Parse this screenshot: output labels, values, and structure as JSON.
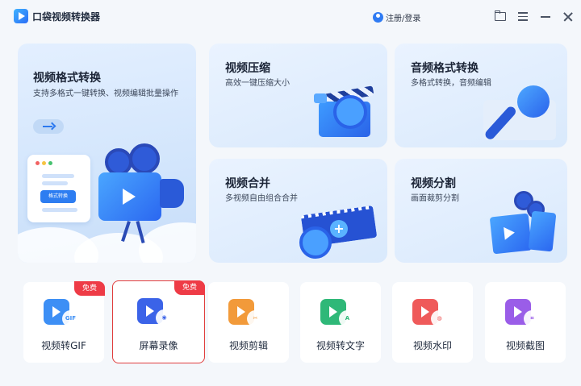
{
  "app": {
    "title": "口袋视频转换器"
  },
  "header": {
    "login_label": "注册/登录"
  },
  "cards": {
    "format_convert": {
      "title": "视频格式转换",
      "desc": "支持多格式一键转换、视频编辑批量操作",
      "mini_button": "格式转换"
    },
    "compress": {
      "title": "视频压缩",
      "desc": "高效一键压缩大小"
    },
    "audio_convert": {
      "title": "音频格式转换",
      "desc": "多格式转换，音频编辑"
    },
    "merge": {
      "title": "视频合并",
      "desc": "多视频自由组合合并"
    },
    "split": {
      "title": "视频分割",
      "desc": "画面裁剪分割"
    }
  },
  "tools": [
    {
      "label": "视频转GIF",
      "badge": "GIF",
      "free": "免费",
      "color": "#3d8ff5"
    },
    {
      "label": "屏幕录像",
      "badge": "◉",
      "free": "免费",
      "color": "#3b63e8"
    },
    {
      "label": "视频剪辑",
      "badge": "✂",
      "color": "#f29a3a"
    },
    {
      "label": "视频转文字",
      "badge": "A",
      "color": "#2fb878"
    },
    {
      "label": "视频水印",
      "badge": "◍",
      "color": "#ef5a5a"
    },
    {
      "label": "视频截图",
      "badge": "⌗",
      "color": "#9a5de8"
    }
  ],
  "colors": {
    "accent": "#2f7bf3",
    "free_tag": "#ee3b46",
    "selection_border": "#e03d3d"
  }
}
